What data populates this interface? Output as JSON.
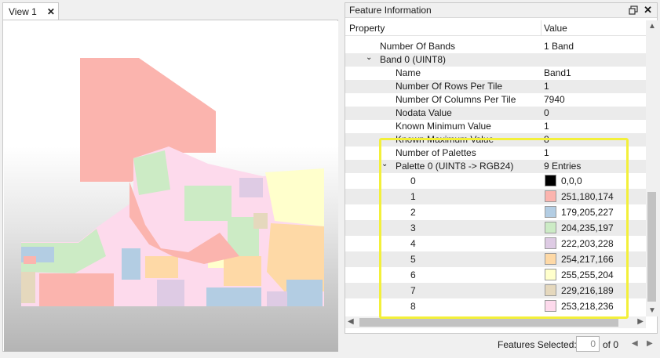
{
  "view_tab": {
    "label": "View 1",
    "close_glyph": "✕"
  },
  "panel": {
    "title": "Feature Information",
    "close_glyph": "✕",
    "columns": {
      "property": "Property",
      "value": "Value"
    }
  },
  "properties": [
    {
      "label": "Number Of Bands",
      "value": "1 Band"
    },
    {
      "label": "Band 0 (UINT8)",
      "value": ""
    },
    {
      "label": "Name",
      "value": "Band1"
    },
    {
      "label": "Number Of Rows Per Tile",
      "value": "1"
    },
    {
      "label": "Number Of Columns Per Tile",
      "value": "7940"
    },
    {
      "label": "Nodata Value",
      "value": "0"
    },
    {
      "label": "Known Minimum Value",
      "value": "1"
    },
    {
      "label": "Known Maximum Value",
      "value": "8"
    },
    {
      "label": "Number of Palettes",
      "value": "1"
    },
    {
      "label": "Palette 0 (UINT8 -> RGB24)",
      "value": "9 Entries"
    }
  ],
  "palette": [
    {
      "index": "0",
      "value": "0,0,0",
      "color": "#000000"
    },
    {
      "index": "1",
      "value": "251,180,174",
      "color": "#fbb4ae"
    },
    {
      "index": "2",
      "value": "179,205,227",
      "color": "#b3cde3"
    },
    {
      "index": "3",
      "value": "204,235,197",
      "color": "#ccebc5"
    },
    {
      "index": "4",
      "value": "222,203,228",
      "color": "#decbe4"
    },
    {
      "index": "5",
      "value": "254,217,166",
      "color": "#fed9a6"
    },
    {
      "index": "6",
      "value": "255,255,204",
      "color": "#ffffcc"
    },
    {
      "index": "7",
      "value": "229,216,189",
      "color": "#e5d8bd"
    },
    {
      "index": "8",
      "value": "253,218,236",
      "color": "#fddaec"
    }
  ],
  "footer": {
    "features_label": "Features Selected:",
    "count_value": "0",
    "of_text": "of 0"
  },
  "colors": {
    "highlight": "#f3f03a",
    "row_alt": "#ebebeb"
  }
}
